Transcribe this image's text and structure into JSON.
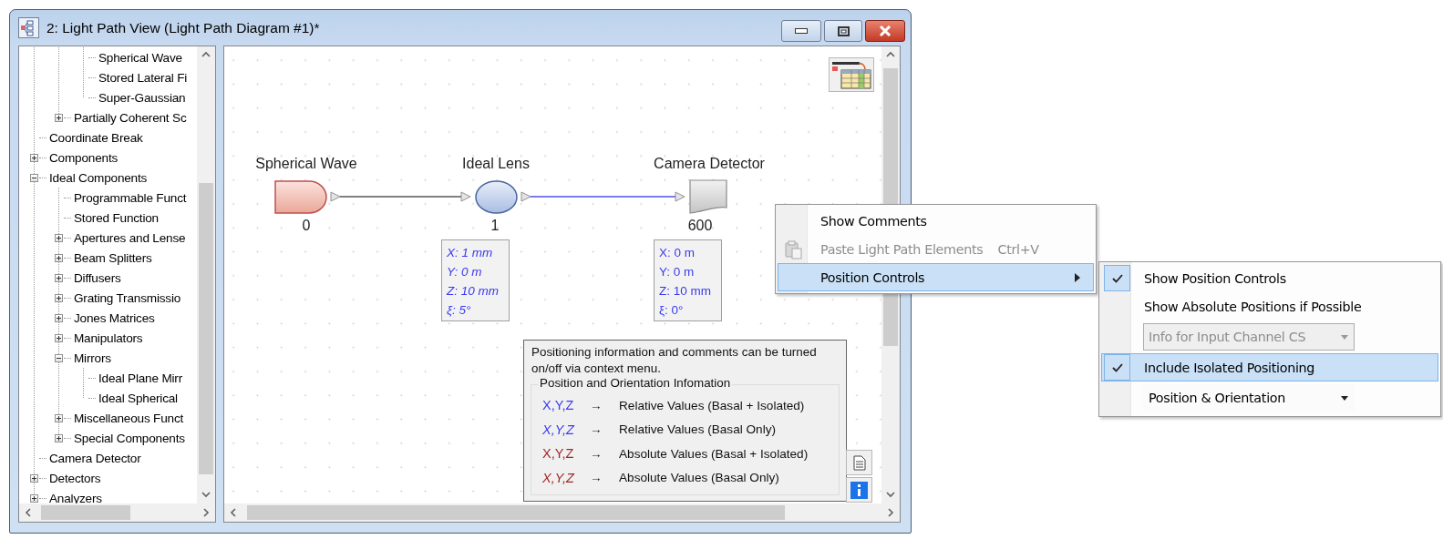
{
  "window": {
    "title": "2: Light Path View (Light Path Diagram #1)*"
  },
  "tree": {
    "items": [
      {
        "children": [
          {
            "children": [
              {
                "label": "Spherical Wave"
              },
              {
                "label": "Stored Lateral Fi"
              },
              {
                "label": "Super-Gaussian"
              }
            ]
          },
          {
            "label": "Partially Coherent Sc",
            "expanded": false
          }
        ]
      },
      {
        "label": "Coordinate Break"
      },
      {
        "label": "Components",
        "expanded": false
      },
      {
        "label": "Ideal Components",
        "expanded": true,
        "children": [
          {
            "label": "Programmable Funct"
          },
          {
            "label": "Stored Function"
          },
          {
            "label": "Apertures and Lense",
            "expanded": false
          },
          {
            "label": "Beam Splitters",
            "expanded": false
          },
          {
            "label": "Diffusers",
            "expanded": false
          },
          {
            "label": "Grating Transmissio",
            "expanded": false
          },
          {
            "label": "Jones Matrices",
            "expanded": false
          },
          {
            "label": "Manipulators",
            "expanded": false
          },
          {
            "label": "Mirrors",
            "expanded": true,
            "children": [
              {
                "label": "Ideal Plane Mirr"
              },
              {
                "label": "Ideal Spherical"
              }
            ]
          },
          {
            "label": "Miscellaneous Funct",
            "expanded": false
          },
          {
            "label": "Special Components",
            "expanded": false
          }
        ]
      },
      {
        "label": "Camera Detector"
      },
      {
        "label": "Detectors",
        "expanded": false
      },
      {
        "label": "Analyzers",
        "expanded": false
      }
    ]
  },
  "diagram": {
    "nodes": [
      {
        "kind": "source",
        "label": "Spherical Wave",
        "index": "0"
      },
      {
        "kind": "lens",
        "label": "Ideal Lens",
        "index": "1",
        "info": {
          "italic": true,
          "lines": [
            "X: 1 mm",
            "Y: 0 m",
            "Z: 10 mm",
            "ξ: 5°"
          ]
        }
      },
      {
        "kind": "detector",
        "label": "Camera Detector",
        "index": "600",
        "info": {
          "italic": false,
          "lines": [
            "X: 0 m",
            "Y: 0 m",
            "Z: 10 mm",
            "ξ: 0°"
          ]
        }
      }
    ],
    "connections": [
      {
        "color": "#808080"
      },
      {
        "color": "#7b7bf2"
      }
    ]
  },
  "legend": {
    "note": "Positioning information and comments can be turned on/off via context menu.",
    "group_title": "Position and Orientation Infomation",
    "rows": [
      {
        "symbol": "X,Y,Z",
        "italic": false,
        "color": "#3c3cf0",
        "arrow": "→",
        "meaning": "Relative Values (Basal + Isolated)"
      },
      {
        "symbol": "X,Y,Z",
        "italic": true,
        "color": "#3c3cf0",
        "arrow": "→",
        "meaning": "Relative Values (Basal Only)"
      },
      {
        "symbol": "X,Y,Z",
        "italic": false,
        "color": "#a02828",
        "arrow": "→",
        "meaning": "Absolute Values (Basal + Isolated)"
      },
      {
        "symbol": "X,Y,Z",
        "italic": true,
        "color": "#a02828",
        "arrow": "→",
        "meaning": "Absolute Values (Basal Only)"
      }
    ]
  },
  "context_menu": {
    "items": [
      {
        "kind": "command",
        "label": "Show Comments",
        "disabled": false,
        "selected": false
      },
      {
        "kind": "command",
        "label": "Paste Light Path Elements",
        "shortcut": "Ctrl+V",
        "disabled": true,
        "selected": false
      },
      {
        "kind": "submenu",
        "label": "Position Controls",
        "disabled": false,
        "selected": true
      }
    ]
  },
  "submenu": {
    "items": [
      {
        "kind": "check",
        "label": "Show Position Controls",
        "checked": true,
        "selected": false
      },
      {
        "kind": "check",
        "label": "Show Absolute Positions if Possible",
        "checked": false,
        "selected": false
      },
      {
        "kind": "dropdown",
        "value": "Info for Input Channel CS",
        "disabled": true
      },
      {
        "kind": "check",
        "label": "Include Isolated Positioning",
        "checked": true,
        "selected": true
      },
      {
        "kind": "dropdown",
        "value": "Position & Orientation",
        "disabled": false
      }
    ]
  }
}
